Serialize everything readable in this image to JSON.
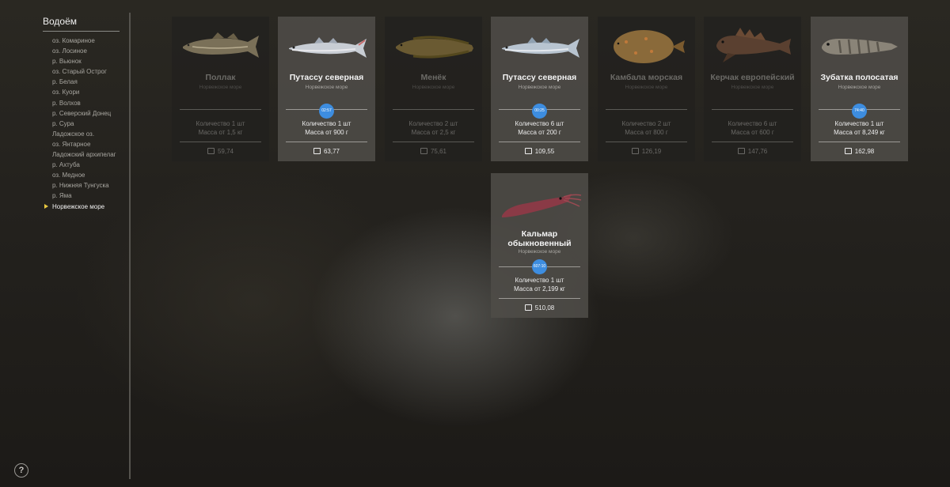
{
  "sidebar": {
    "title": "Водоём",
    "items": [
      "оз. Комариное",
      "оз. Лосиное",
      "р. Вьюнок",
      "оз. Старый Острог",
      "р. Белая",
      "оз. Куори",
      "р. Волхов",
      "р. Северский Донец",
      "р. Сура",
      "Ладожское оз.",
      "оз. Янтарное",
      "Ладожский архипелаг",
      "р. Ахтуба",
      "оз. Медное",
      "р. Нижняя Тунгуска",
      "р. Яма",
      "Норвежское море"
    ],
    "active_index": 16
  },
  "help": {
    "label": "?"
  },
  "colors": {
    "accent_badge": "#3d8de0",
    "active_marker": "#e8c840"
  },
  "cards": [
    {
      "name": "Поллак",
      "location": "Норвежское море",
      "qty": "Количество 1 шт",
      "mass": "Масса от 1,5 кг",
      "price": "59,74",
      "highlighted": false,
      "icon": "pollock-fish-icon"
    },
    {
      "name": "Путассу северная",
      "location": "Норвежское море",
      "qty": "Количество 1 шт",
      "mass": "Масса от 900 г",
      "price": "63,77",
      "highlighted": true,
      "badge": "02:57",
      "icon": "blue-whiting-fish-icon"
    },
    {
      "name": "Менёк",
      "location": "Норвежское море",
      "qty": "Количество 2 шт",
      "mass": "Масса от 2,5 кг",
      "price": "75,61",
      "highlighted": false,
      "icon": "tusk-fish-icon"
    },
    {
      "name": "Путассу северная",
      "location": "Норвежское море",
      "qty": "Количество 6 шт",
      "mass": "Масса от 200 г",
      "price": "109,55",
      "highlighted": true,
      "badge": "00:25",
      "icon": "blue-whiting-fish-icon"
    },
    {
      "name": "Камбала морская",
      "location": "Норвежское море",
      "qty": "Количество 2 шт",
      "mass": "Масса от 800 г",
      "price": "126,19",
      "highlighted": false,
      "icon": "plaice-fish-icon"
    },
    {
      "name": "Керчак европейский",
      "location": "Норвежское море",
      "qty": "Количество 6 шт",
      "mass": "Масса от 600 г",
      "price": "147,76",
      "highlighted": false,
      "icon": "sculpin-fish-icon"
    },
    {
      "name": "Зубатка полосатая",
      "location": "Норвежское море",
      "qty": "Количество 1 шт",
      "mass": "Масса от 8,249 кг",
      "price": "162,98",
      "highlighted": true,
      "badge": "74:40",
      "icon": "wolffish-fish-icon"
    },
    {
      "name": "Кальмар обыкновенный",
      "location": "Норвежское море",
      "qty": "Количество 1 шт",
      "mass": "Масса от 2,199 кг",
      "price": "510,08",
      "highlighted": true,
      "badge": "607:10",
      "icon": "squid-icon"
    }
  ]
}
